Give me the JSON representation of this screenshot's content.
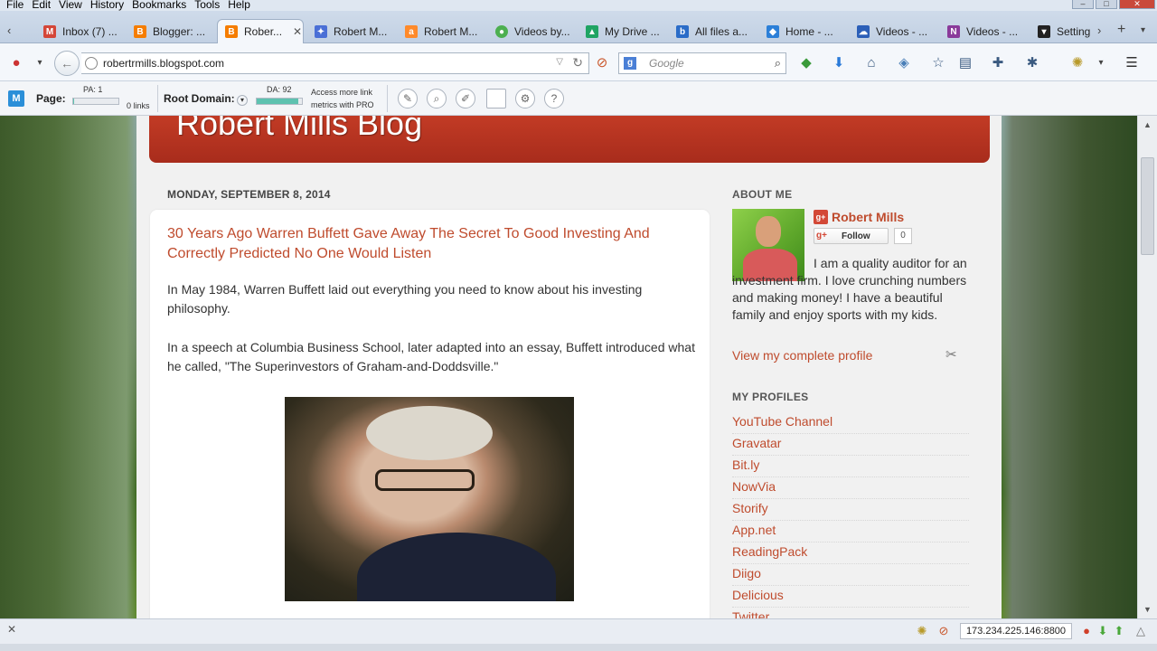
{
  "menu": [
    "File",
    "Edit",
    "View",
    "History",
    "Bookmarks",
    "Tools",
    "Help"
  ],
  "tabs": [
    {
      "label": "Inbox (7) ...",
      "icon": "gmail-icon",
      "color": "#d44638"
    },
    {
      "label": "Blogger: ...",
      "icon": "blogger-icon",
      "color": "#f57d00"
    },
    {
      "label": "Rober...",
      "icon": "blogger-icon",
      "color": "#f57d00",
      "active": true
    },
    {
      "label": "Robert M...",
      "icon": "puzzle-icon",
      "color": "#4a6fd6"
    },
    {
      "label": "Robert M...",
      "icon": "about-me-icon",
      "color": "#ff8a2a"
    },
    {
      "label": "Videos by...",
      "icon": "chrome-icon",
      "color": "#4caf50"
    },
    {
      "label": "My Drive ...",
      "icon": "drive-icon",
      "color": "#1fa463"
    },
    {
      "label": "All files a...",
      "icon": "box-icon",
      "color": "#2a6cc8"
    },
    {
      "label": "Home - ...",
      "icon": "dropbox-icon",
      "color": "#2b7fd8"
    },
    {
      "label": "Videos - ...",
      "icon": "onedrive-icon",
      "color": "#2b5fb8"
    },
    {
      "label": "Videos - ...",
      "icon": "onenote-icon",
      "color": "#8a3a9a"
    },
    {
      "label": "Setting",
      "icon": "settings-tab-icon",
      "color": "#222222"
    }
  ],
  "nav": {
    "url": "robertrmills.blogspot.com",
    "search_placeholder": "Google"
  },
  "mozbar": {
    "page_label": "Page:",
    "pa": "PA: 1",
    "links": "0 links",
    "root_label": "Root Domain:",
    "da": "DA: 92",
    "da_fill": 0.92,
    "pa_fill": 0.01,
    "pro_line1": "Access more link",
    "pro_line2": "metrics with PRO"
  },
  "blog": {
    "title": "Robert Mills  Blog",
    "date": "MONDAY, SEPTEMBER 8, 2014",
    "post_title": "30 Years Ago Warren Buffett Gave Away The Secret To Good Investing And Correctly Predicted No One Would Listen",
    "para1": "In May 1984, Warren Buffett laid out everything you need to know about his investing philosophy.",
    "para2": "In a speech at Columbia Business School, later adapted into an essay, Buffett introduced what he called, \"The Superinvestors of Graham-and-Doddsville.\""
  },
  "sidebar": {
    "about_heading": "ABOUT ME",
    "name": "Robert Mills",
    "follow_label": "Follow",
    "follow_count": "0",
    "about_text": "I am a quality auditor for an investment firm. I love crunching numbers and making money! I have a beautiful family and enjoy sports with my kids.",
    "view_profile": "View my complete profile",
    "profiles_heading": "MY PROFILES",
    "profiles": [
      "YouTube Channel",
      "Gravatar",
      "Bit.ly",
      "NowVia",
      "Storify",
      "App.net",
      "ReadingPack",
      "Diigo",
      "Delicious",
      "Twitter"
    ]
  },
  "status": {
    "ip": "173.234.225.146:8800"
  }
}
